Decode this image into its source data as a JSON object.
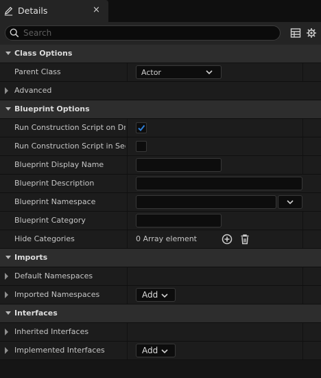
{
  "tab": {
    "title": "Details",
    "close": "×"
  },
  "search": {
    "placeholder": "Search",
    "value": ""
  },
  "categories": {
    "class_options": "Class Options",
    "blueprint_options": "Blueprint Options",
    "imports": "Imports",
    "interfaces": "Interfaces"
  },
  "properties": {
    "parent_class": {
      "label": "Parent Class",
      "value": "Actor"
    },
    "advanced": {
      "label": "Advanced"
    },
    "run_on_drag": {
      "label": "Run Construction Script on Drag",
      "checked": true
    },
    "run_in_sequencer": {
      "label": "Run Construction Script in Seq...",
      "checked": false
    },
    "display_name": {
      "label": "Blueprint Display Name",
      "value": ""
    },
    "description": {
      "label": "Blueprint Description",
      "value": ""
    },
    "namespace": {
      "label": "Blueprint Namespace",
      "value": ""
    },
    "category": {
      "label": "Blueprint Category",
      "value": ""
    },
    "hide_categories": {
      "label": "Hide Categories",
      "value": "0 Array element"
    },
    "default_namespaces": {
      "label": "Default Namespaces"
    },
    "imported_namespaces": {
      "label": "Imported Namespaces",
      "button": "Add"
    },
    "inherited_interfaces": {
      "label": "Inherited Interfaces"
    },
    "implemented_interfaces": {
      "label": "Implemented Interfaces",
      "button": "Add"
    }
  },
  "icons": {
    "tab": "pencil-icon",
    "search": "search-icon",
    "table_view": "table-view-icon",
    "settings": "gear-icon",
    "add_element": "plus-circle-icon",
    "clear": "trash-icon",
    "dropdown": "chevron-down-icon"
  },
  "colors": {
    "background": "#151515",
    "category_row": "#2d2d2d",
    "property_row": "#1c1c1c",
    "checkbox_accent": "#2e7fd8"
  }
}
